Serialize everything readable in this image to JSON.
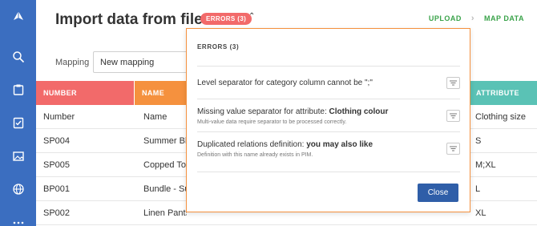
{
  "header": {
    "title": "Import data from file",
    "errors_badge": "ERRORS (3)",
    "steps": [
      "UPLOAD",
      "MAP DATA"
    ]
  },
  "mapping": {
    "label": "Mapping",
    "value": "New mapping"
  },
  "table": {
    "columns": [
      "NUMBER",
      "NAME",
      "ATTRIBUTE"
    ],
    "field_row": {
      "number": "Number",
      "name": "Name",
      "attribute": "Clothing size"
    },
    "rows": [
      {
        "number": "SP004",
        "name": "Summer Blo",
        "attribute": "S"
      },
      {
        "number": "SP005",
        "name": "Copped To",
        "attribute": "M;XL"
      },
      {
        "number": "BP001",
        "name": "Bundle - Su",
        "attribute": "L"
      },
      {
        "number": "SP002",
        "name": "Linen Pants",
        "attribute": "XL"
      }
    ]
  },
  "errors_panel": {
    "title": "ERRORS (3)",
    "errors": [
      {
        "text": "Level separator for category column cannot be \";\"",
        "bold": "",
        "detail": ""
      },
      {
        "text": "Missing value separator for attribute: ",
        "bold": "Clothing colour",
        "detail": "Multi-value data require separator to be processed correctly."
      },
      {
        "text": "Duplicated relations definition: ",
        "bold": "you may also like",
        "detail": "Definition with this name already exists in PIM."
      }
    ],
    "close_label": "Close"
  },
  "colors": {
    "sidebar": "#3b6ec0",
    "errors_badge": "#f26a6a",
    "number_header": "#f26a6a",
    "name_header": "#f5913e",
    "attribute_header": "#5ac2b5",
    "step_active": "#3aa34a",
    "close_button": "#2f5ea8"
  },
  "icons": {
    "sidebar": [
      "logo-icon",
      "search-icon",
      "clipboard-icon",
      "checklist-icon",
      "image-icon",
      "globe-icon",
      "more-icon"
    ],
    "error_action": "filter-lines-icon"
  }
}
